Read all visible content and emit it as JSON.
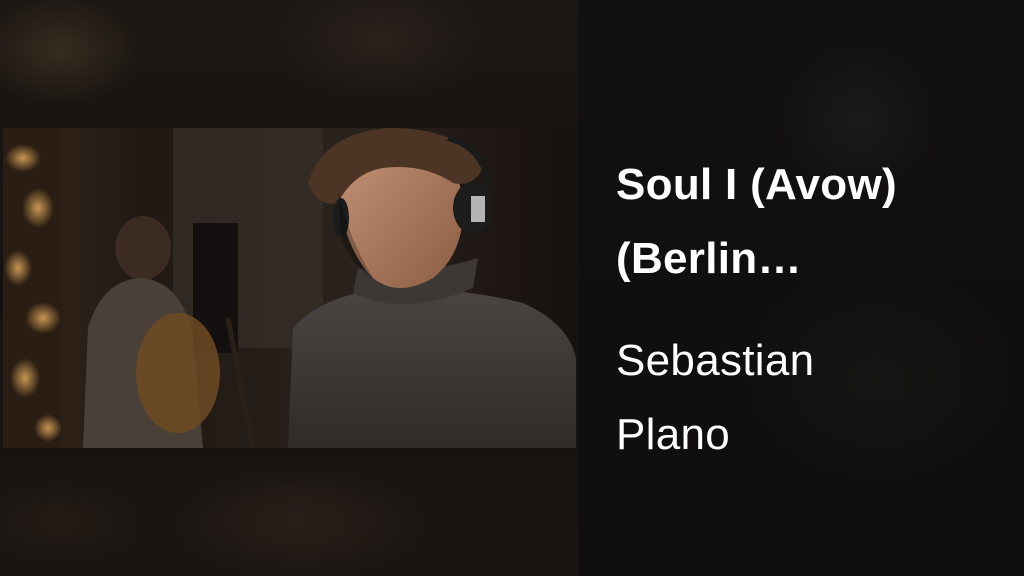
{
  "track": {
    "title_line_1": "Soul I (Avow)",
    "title_line_2": "(Berlin…"
  },
  "artist": {
    "name_line_1": "Sebastian",
    "name_line_2": "Plano"
  },
  "colors": {
    "text": "#ffffff",
    "background": "#0f0e0e"
  }
}
